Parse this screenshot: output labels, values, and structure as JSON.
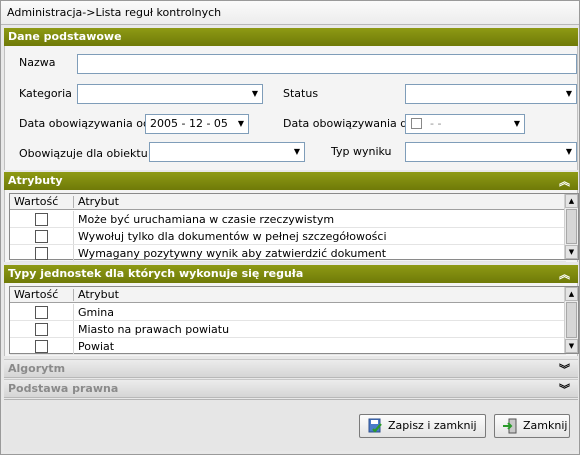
{
  "title": "Administracja->Lista reguł kontrolnych",
  "sections": {
    "basic": "Dane podstawowe",
    "attributes": "Atrybuty",
    "unit_types": "Typy jednostek dla których wykonuje się reguła",
    "algorithm": "Algorytm",
    "legal_basis": "Podstawa prawna"
  },
  "form": {
    "name_label": "Nazwa",
    "name_value": "",
    "category_label": "Kategoria",
    "category_value": "",
    "status_label": "Status",
    "status_value": "",
    "valid_from_label": "Data obowiązywania od:",
    "valid_from_value": "2005 - 12 - 05",
    "valid_to_label": "Data obowiązywania do:",
    "valid_to_value": "   -   -   ",
    "applies_label": "Obowiązuje dla obiektu:",
    "applies_value": "",
    "result_type_label": "Typ wyniku",
    "result_type_value": ""
  },
  "attributes_grid": {
    "columns": [
      "Wartość",
      "Atrybut"
    ],
    "rows": [
      {
        "checked": false,
        "label": "Może być uruchamiana w czasie rzeczywistym"
      },
      {
        "checked": false,
        "label": "Wywołuj tylko dla dokumentów w pełnej szczegółowości"
      },
      {
        "checked": false,
        "label": "Wymagany pozytywny wynik aby zatwierdzić dokument"
      }
    ]
  },
  "units_grid": {
    "columns": [
      "Wartość",
      "Atrybut"
    ],
    "rows": [
      {
        "checked": false,
        "label": "Gmina"
      },
      {
        "checked": false,
        "label": "Miasto na prawach powiatu"
      },
      {
        "checked": false,
        "label": "Powiat"
      }
    ]
  },
  "buttons": {
    "save_close": "Zapisz i zamknij",
    "close": "Zamknij"
  },
  "icons": {
    "collapse": "double-chevron-up-icon",
    "expand": "double-chevron-down-icon",
    "combo": "triangle-down-icon",
    "save": "save-disk-icon",
    "exit": "exit-door-icon"
  }
}
